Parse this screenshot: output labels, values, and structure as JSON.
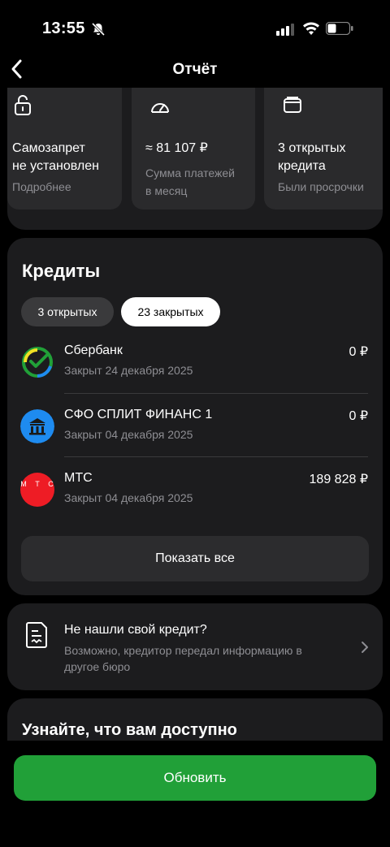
{
  "status_bar": {
    "time": "13:55"
  },
  "nav": {
    "title": "Отчёт"
  },
  "summary": [
    {
      "icon": "lock-icon",
      "value": "Самозапрет\nне установлен",
      "subtitle": "Подробнее"
    },
    {
      "icon": "gauge-icon",
      "value": "≈ 81 107 ₽",
      "subtitle": "Сумма платежей\nв месяц"
    },
    {
      "icon": "wallet-icon",
      "value": "3 открытых\nкредита",
      "subtitle": "Были просрочки"
    }
  ],
  "credits": {
    "title": "Кредиты",
    "tabs": {
      "open": "3 открытых",
      "closed": "23 закрытых"
    },
    "items": [
      {
        "name": "Сбербанк",
        "date": "Закрыт 24 декабря 2025",
        "amount": "0 ₽"
      },
      {
        "name": "СФО СПЛИТ ФИНАНС 1",
        "date": "Закрыт 04 декабря 2025",
        "amount": "0 ₽"
      },
      {
        "name": "МТС",
        "date": "Закрыт 04 декабря 2025",
        "amount": "189 828 ₽",
        "logo_text": "М Т С"
      }
    ],
    "show_all": "Показать все"
  },
  "not_found": {
    "title": "Не нашли свой кредит?",
    "description": "Возможно, кредитор передал информацию в другое бюро"
  },
  "available": {
    "title": "Узнайте, что вам доступно"
  },
  "update_button": "Обновить",
  "colors": {
    "accent_green": "#21a038",
    "bank_blue": "#1e8bf0",
    "mts_red": "#ee1c25",
    "card_bg": "#1c1c1e"
  }
}
